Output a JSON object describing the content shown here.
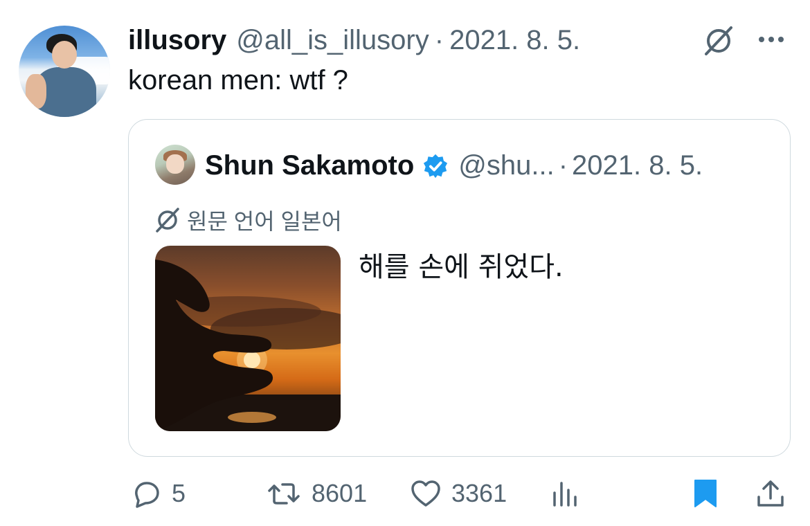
{
  "tweet": {
    "author_name": "illusory",
    "author_handle": "@all_is_illusory",
    "separator": "·",
    "date": "2021. 8. 5.",
    "text": "korean men: wtf ?"
  },
  "quoted": {
    "author_name": "Shun Sakamoto",
    "author_handle": "@shu...",
    "separator": "·",
    "date": "2021. 8. 5.",
    "translate_label": "원문 언어 일본어",
    "text": "해를 손에 쥐었다.",
    "verified": true
  },
  "actions": {
    "replies": "5",
    "reposts": "8601",
    "likes": "3361",
    "bookmarked": true
  },
  "colors": {
    "text_primary": "#0f1419",
    "text_secondary": "#536471",
    "accent_blue": "#1d9bf0",
    "border": "#cfd9de"
  },
  "icons": [
    "grok-icon",
    "more-icon",
    "verified-badge-icon",
    "translate-icon",
    "reply-icon",
    "repost-icon",
    "like-icon",
    "views-icon",
    "bookmark-icon",
    "share-icon"
  ]
}
